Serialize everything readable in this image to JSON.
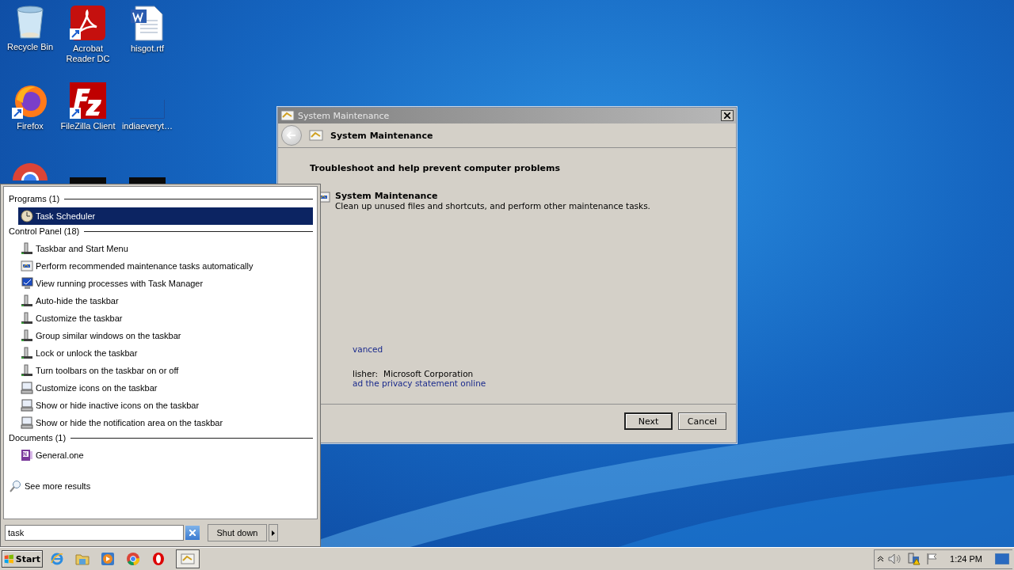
{
  "desktop_icons": [
    {
      "label": "Recycle Bin",
      "kind": "bin"
    },
    {
      "label": "Acrobat Reader DC",
      "kind": "acrobat"
    },
    {
      "label": "hisgot.rtf",
      "kind": "document"
    },
    {
      "label": "Firefox",
      "kind": "firefox"
    },
    {
      "label": "FileZilla Client",
      "kind": "filezilla"
    },
    {
      "label": "indiaeveryt…",
      "kind": "blank"
    },
    {
      "kind": "chrome"
    },
    {
      "kind": "dark"
    },
    {
      "kind": "dark"
    }
  ],
  "dialog": {
    "title": "System Maintenance",
    "header": "System Maintenance",
    "heading": "Troubleshoot and help prevent computer problems",
    "task_title": "System Maintenance",
    "task_description": "Clean up unused files and shortcuts, and perform other maintenance tasks.",
    "advanced_link": "vanced",
    "publisher_label": "lisher:",
    "publisher": "Microsoft Corporation",
    "privacy_link": "ad the privacy statement online",
    "buttons": [
      {
        "label": "Next",
        "default": true
      },
      {
        "label": "Cancel",
        "default": false
      }
    ]
  },
  "start_menu": {
    "groups": [
      {
        "heading": "Programs (1)",
        "items": [
          {
            "label": "Task Scheduler",
            "kind": "clock",
            "selected": true
          }
        ]
      },
      {
        "heading": "Control Panel (18)",
        "items": [
          {
            "label": "Taskbar and Start Menu",
            "kind": "taskbar",
            "selected": false
          },
          {
            "label": "Perform recommended maintenance tasks automatically",
            "kind": "maintenance",
            "selected": false
          },
          {
            "label": "View running processes with Task Manager",
            "kind": "taskmgr",
            "selected": false
          },
          {
            "label": "Auto-hide the taskbar",
            "kind": "taskbar",
            "selected": false
          },
          {
            "label": "Customize the taskbar",
            "kind": "taskbar",
            "selected": false
          },
          {
            "label": "Group similar windows on the taskbar",
            "kind": "taskbar",
            "selected": false
          },
          {
            "label": "Lock or unlock the taskbar",
            "kind": "taskbar",
            "selected": false
          },
          {
            "label": "Turn toolbars on the taskbar on or off",
            "kind": "taskbar",
            "selected": false
          },
          {
            "label": "Customize icons on the taskbar",
            "kind": "monitor",
            "selected": false
          },
          {
            "label": "Show or hide inactive icons on the taskbar",
            "kind": "monitor",
            "selected": false
          },
          {
            "label": "Show or hide the notification area on the taskbar",
            "kind": "monitor",
            "selected": false
          }
        ]
      },
      {
        "heading": "Documents (1)",
        "items": [
          {
            "label": "General.one",
            "kind": "onenote",
            "selected": false
          }
        ]
      }
    ],
    "see_more": "See more results",
    "search": {
      "value": "task"
    },
    "shutdown": "Shut down"
  },
  "taskbar": {
    "start": "Start",
    "quick_launch": [
      {
        "kind": "ie"
      },
      {
        "kind": "folder"
      },
      {
        "kind": "media"
      },
      {
        "kind": "chrome"
      },
      {
        "kind": "opera"
      }
    ],
    "tasks": [
      {
        "kind": "maintenance",
        "selected": true
      }
    ],
    "clock": "1:24 PM"
  }
}
